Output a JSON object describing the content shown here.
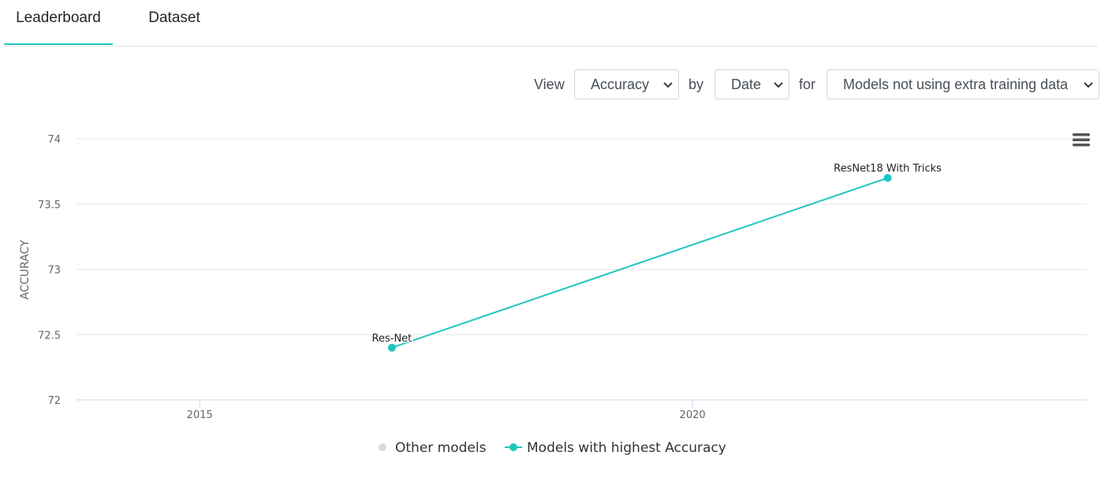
{
  "tabs": {
    "leaderboard": "Leaderboard",
    "dataset": "Dataset"
  },
  "controls": {
    "view_label": "View",
    "view_value": "Accuracy",
    "by_label": "by",
    "by_value": "Date",
    "for_label": "for",
    "for_value": "Models not using extra training data"
  },
  "colors": {
    "accent": "#21c5c0",
    "other": "#d9d9d9",
    "grid": "#e6e6e6",
    "axis": "#ccd6eb"
  },
  "icons": {
    "menu": "hamburger-menu-icon",
    "dropdown": "chevron-down-icon"
  },
  "chart_data": {
    "type": "line",
    "xlabel": "",
    "ylabel": "ACCURACY",
    "xlim": [
      2013.75,
      2024.0
    ],
    "ylim": [
      72,
      74
    ],
    "x_ticks": [
      2015,
      2020
    ],
    "y_ticks": [
      72,
      72.5,
      73,
      73.5,
      74
    ],
    "grid": true,
    "legend_position": "bottom",
    "series": [
      {
        "name": "Other models",
        "color": "#d9d9d9",
        "points": []
      },
      {
        "name": "Models with highest Accuracy",
        "color": "#21c5c0",
        "points": [
          {
            "x": 2016.95,
            "y": 72.4,
            "label": "Res-Net"
          },
          {
            "x": 2021.98,
            "y": 73.7,
            "label": "ResNet18 With Tricks"
          }
        ]
      }
    ]
  }
}
